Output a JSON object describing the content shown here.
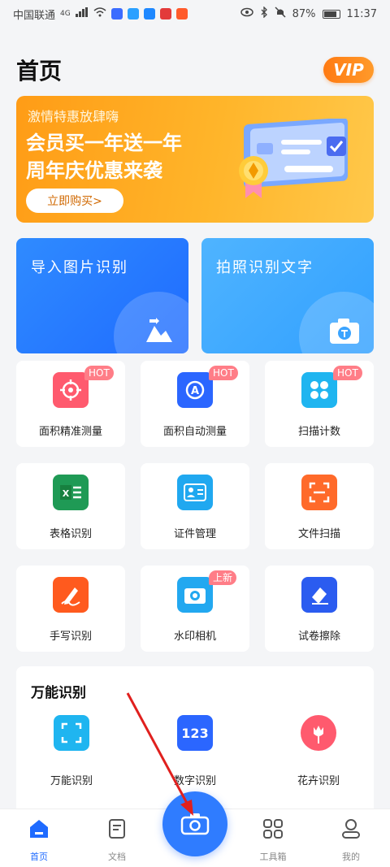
{
  "status_bar": {
    "carrier": "中国联通",
    "network": "4G",
    "battery": "87%",
    "time": "11:37"
  },
  "header": {
    "title": "首页",
    "vip_label": "VIP"
  },
  "banner": {
    "subtitle": "激情特惠放肆嗨",
    "line1": "会员买一年送一年",
    "line2": "周年庆优惠来袭",
    "button": "立即购买>"
  },
  "big_cards": {
    "import_label": "导入图片识别",
    "photo_label": "拍照识别文字"
  },
  "tiles": [
    {
      "label": "面积精准测量",
      "badge": "HOT"
    },
    {
      "label": "面积自动测量",
      "badge": "HOT"
    },
    {
      "label": "扫描计数",
      "badge": "HOT"
    },
    {
      "label": "表格识别"
    },
    {
      "label": "证件管理"
    },
    {
      "label": "文件扫描"
    },
    {
      "label": "手写识别"
    },
    {
      "label": "水印相机",
      "badge": "上新"
    },
    {
      "label": "试卷擦除"
    }
  ],
  "universal": {
    "title": "万能识别",
    "items": [
      {
        "label": "万能识别"
      },
      {
        "label": "数字识别",
        "icon_text": "123"
      },
      {
        "label": "花卉识别"
      }
    ]
  },
  "tabbar": {
    "home": "首页",
    "docs": "文档",
    "tools": "工具箱",
    "mine": "我的"
  },
  "colors": {
    "accent": "#1f6bff",
    "vip": "#ff8a1a",
    "banner": "#ffa81f",
    "hot_badge": "#ff7d87"
  }
}
